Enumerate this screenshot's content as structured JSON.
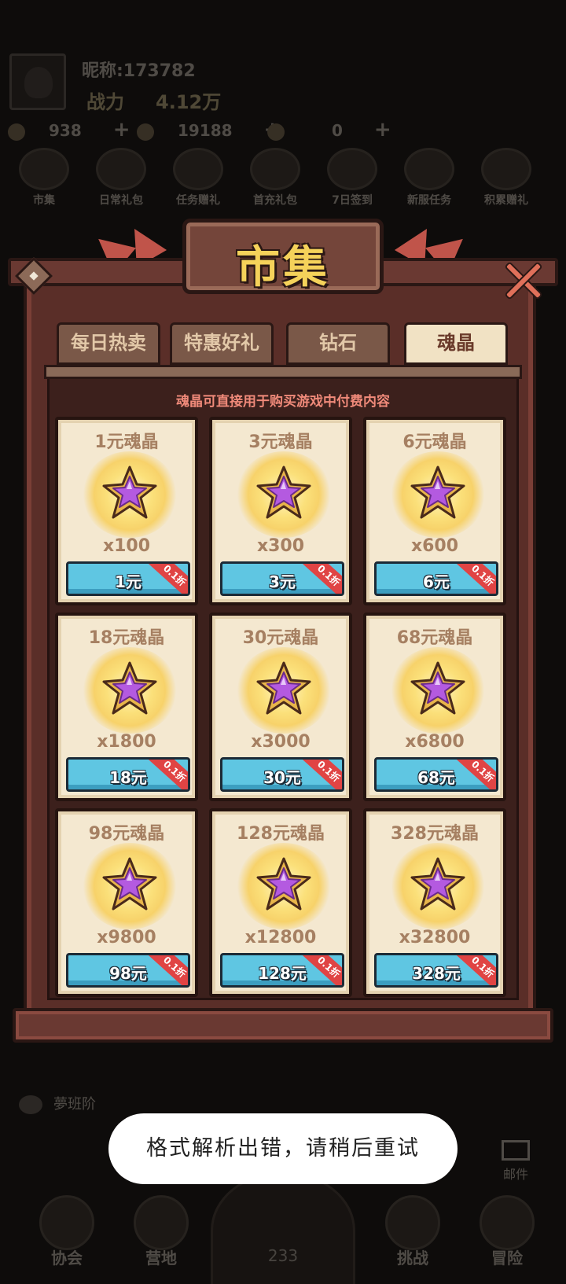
{
  "background": {
    "nickname": "昵称:173782",
    "power_label": "战力",
    "power_value": "4.12万",
    "currencies": [
      {
        "icon": "gem-icon",
        "value": "938"
      },
      {
        "icon": "coin-icon",
        "value": "19188"
      },
      {
        "icon": "crystal-icon",
        "value": "0"
      }
    ],
    "hud_icons": [
      {
        "icon": "market-icon",
        "label": "市集"
      },
      {
        "icon": "gift-icon",
        "label": "日常礼包"
      },
      {
        "icon": "gift-icon",
        "label": "任务赠礼"
      },
      {
        "icon": "gift-icon",
        "label": "首充礼包"
      },
      {
        "icon": "calendar-icon",
        "label": "7日签到"
      },
      {
        "icon": "task-icon",
        "label": "新服任务"
      },
      {
        "icon": "gift-icon",
        "label": "积累赠礼"
      }
    ],
    "chat_label": "夢班阶",
    "mail_label": "邮件",
    "nav": [
      {
        "icon": "guild-icon",
        "label": "协会"
      },
      {
        "icon": "camp-icon",
        "label": "营地"
      },
      {
        "icon": "battle-icon",
        "label": "挑战"
      },
      {
        "icon": "adventure-icon",
        "label": "冒险"
      }
    ],
    "center_value": "233"
  },
  "market": {
    "title": "市集",
    "tabs": [
      {
        "label": "每日热卖",
        "active": false
      },
      {
        "label": "特惠好礼",
        "active": false
      },
      {
        "label": "钻石",
        "active": false
      },
      {
        "label": "魂晶",
        "active": true
      }
    ],
    "subtitle": "魂晶可直接用于购买游戏中付费内容",
    "discount_label": "0.1折",
    "items": [
      {
        "title": "1元魂晶",
        "qty": "x100",
        "price": "1元"
      },
      {
        "title": "3元魂晶",
        "qty": "x300",
        "price": "3元"
      },
      {
        "title": "6元魂晶",
        "qty": "x600",
        "price": "6元"
      },
      {
        "title": "18元魂晶",
        "qty": "x1800",
        "price": "18元"
      },
      {
        "title": "30元魂晶",
        "qty": "x3000",
        "price": "30元"
      },
      {
        "title": "68元魂晶",
        "qty": "x6800",
        "price": "68元"
      },
      {
        "title": "98元魂晶",
        "qty": "x9800",
        "price": "98元"
      },
      {
        "title": "128元魂晶",
        "qty": "x12800",
        "price": "128元"
      },
      {
        "title": "328元魂晶",
        "qty": "x32800",
        "price": "328元"
      }
    ]
  },
  "toast": {
    "message": "格式解析出错，请稍后重试"
  },
  "colors": {
    "accent_title": "#f5d25a",
    "buy_button": "#5fc6e2",
    "discount_ribbon": "#e04444",
    "subtitle": "#f08a7a"
  }
}
